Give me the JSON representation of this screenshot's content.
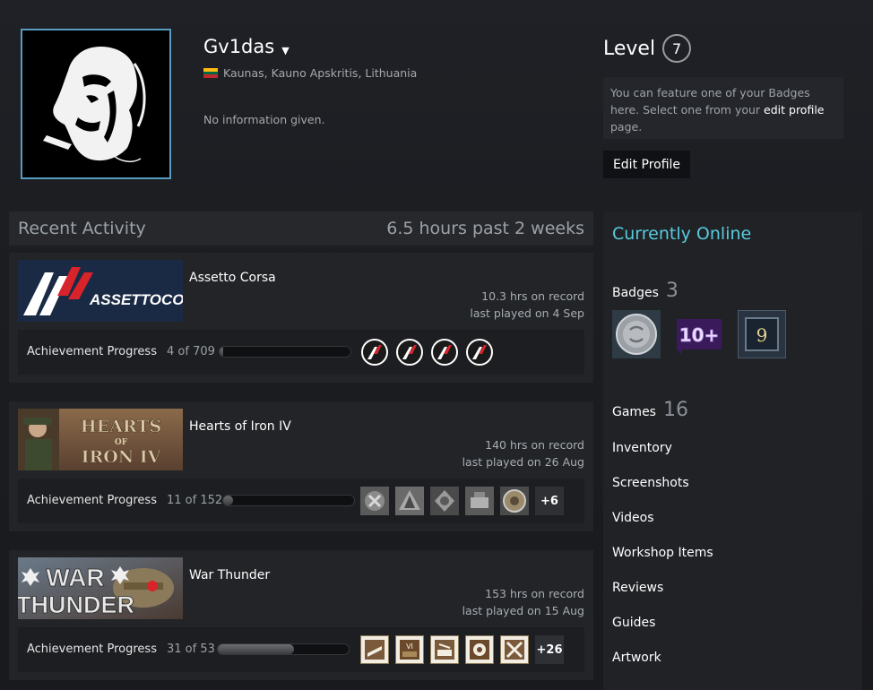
{
  "profile": {
    "name": "Gv1das",
    "location": "Kaunas, Kauno Apskritis, Lithuania",
    "summary": "No information given."
  },
  "level": {
    "label": "Level",
    "value": "7",
    "hint_prefix": "You can feature one of your Badges here. Select one from your ",
    "hint_link": "edit profile",
    "hint_suffix": " page.",
    "edit_button": "Edit Profile"
  },
  "activity": {
    "title": "Recent Activity",
    "hours": "6.5 hours past 2 weeks",
    "games": [
      {
        "name": "Assetto Corsa",
        "hours": "10.3 hrs on record",
        "last_played": "last played on 4 Sep",
        "ach_label": "Achievement Progress",
        "ach_count": "4 of 709",
        "ach_progress": 0.0056,
        "more": ""
      },
      {
        "name": "Hearts of Iron IV",
        "hours": "140 hrs on record",
        "last_played": "last played on 26 Aug",
        "ach_label": "Achievement Progress",
        "ach_count": "11 of 152",
        "ach_progress": 0.072,
        "more": "+6"
      },
      {
        "name": "War Thunder",
        "hours": "153 hrs on record",
        "last_played": "last played on 15 Aug",
        "ach_label": "Achievement Progress",
        "ach_count": "31 of 53",
        "ach_progress": 0.585,
        "more": "+26"
      }
    ]
  },
  "capsules": {
    "ac_text": "ASSETTOCORSA",
    "hoi_line1": "HEARTS",
    "hoi_line2": "OF",
    "hoi_line3": "IRON IV",
    "wt_line1": "WAR",
    "wt_line2": "THUNDER"
  },
  "sidebar": {
    "status": "Currently Online",
    "badges_label": "Badges",
    "badges_count": "3",
    "badge2_text": "10+",
    "badge3_text": "9",
    "games_label": "Games",
    "games_count": "16",
    "links": [
      "Inventory",
      "Screenshots",
      "Videos",
      "Workshop Items",
      "Reviews",
      "Guides",
      "Artwork"
    ]
  },
  "colors": {
    "accent_online": "#57cbde",
    "avatar_border": "#5a9bc0"
  }
}
